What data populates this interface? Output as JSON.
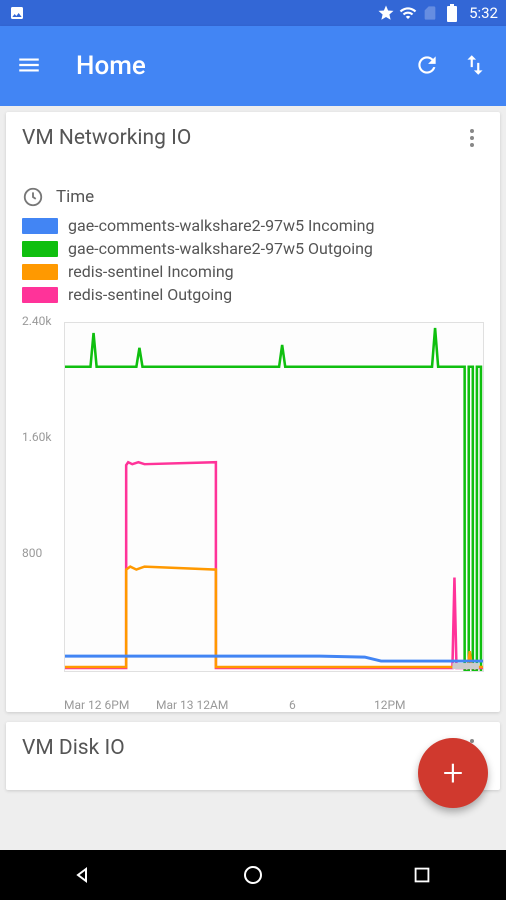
{
  "status": {
    "time": "5:32"
  },
  "appbar": {
    "title": "Home"
  },
  "card1": {
    "title": "VM Networking IO",
    "time_label": "Time",
    "legend": [
      {
        "label": "gae-comments-walkshare2-97w5 Incoming",
        "color": "#4285F4"
      },
      {
        "label": "gae-comments-walkshare2-97w5 Outgoing",
        "color": "#0FBF0F"
      },
      {
        "label": "redis-sentinel Incoming",
        "color": "#FF9900"
      },
      {
        "label": "redis-sentinel Outgoing",
        "color": "#FF3399"
      }
    ],
    "y_ticks": [
      "2.40k",
      "1.60k",
      "800"
    ],
    "x_ticks": [
      "Mar 12 6PM",
      "Mar 13 12AM",
      "6",
      "12PM"
    ]
  },
  "card2": {
    "title": "VM Disk IO"
  },
  "fab": {
    "label": "+"
  },
  "chart_data": {
    "type": "line",
    "title": "VM Networking IO",
    "xlabel": "Time",
    "ylabel": "",
    "ylim": [
      0,
      2400
    ],
    "x_range": [
      "Mar 12 6PM",
      "Mar 13 ~4PM"
    ],
    "series": [
      {
        "name": "gae-comments-walkshare2-97w5 Incoming",
        "color": "#4285F4",
        "approx_values": [
          {
            "x": "Mar 12 6PM",
            "y": 100
          },
          {
            "x": "Mar 13 12AM",
            "y": 100
          },
          {
            "x": "Mar 13 6AM",
            "y": 100
          },
          {
            "x": "Mar 13 12PM",
            "y": 100
          },
          {
            "x": "Mar 13 4PM",
            "y": 100
          }
        ]
      },
      {
        "name": "gae-comments-walkshare2-97w5 Outgoing",
        "color": "#0FBF0F",
        "approx_values": [
          {
            "x": "Mar 12 6PM",
            "y": 2100
          },
          {
            "x": "Mar 12 7PM_spike",
            "y": 2350
          },
          {
            "x": "Mar 13 12AM",
            "y": 2100
          },
          {
            "x": "Mar 13 3AM_spike",
            "y": 2300
          },
          {
            "x": "Mar 13 6AM",
            "y": 2100
          },
          {
            "x": "Mar 13 12PM",
            "y": 2100
          },
          {
            "x": "Mar 13 2PM_spike",
            "y": 2400
          },
          {
            "x": "Mar 13 4PM",
            "y": 2100
          },
          {
            "x": "Mar 13 4PM_drop",
            "y": 0
          }
        ]
      },
      {
        "name": "redis-sentinel Incoming",
        "color": "#FF9900",
        "approx_values": [
          {
            "x": "Mar 12 6PM",
            "y": 30
          },
          {
            "x": "Mar 12 8PM",
            "y": 30
          },
          {
            "x": "Mar 12 8PM_step",
            "y": 700
          },
          {
            "x": "Mar 13 12AM",
            "y": 700
          },
          {
            "x": "Mar 13 1AM_drop",
            "y": 30
          },
          {
            "x": "Mar 13 6AM",
            "y": 30
          },
          {
            "x": "Mar 13 12PM",
            "y": 30
          },
          {
            "x": "Mar 13 4PM",
            "y": 30
          }
        ]
      },
      {
        "name": "redis-sentinel Outgoing",
        "color": "#FF3399",
        "approx_values": [
          {
            "x": "Mar 12 6PM",
            "y": 20
          },
          {
            "x": "Mar 12 8PM",
            "y": 20
          },
          {
            "x": "Mar 12 8PM_step",
            "y": 1420
          },
          {
            "x": "Mar 13 12AM",
            "y": 1420
          },
          {
            "x": "Mar 13 1AM_drop",
            "y": 20
          },
          {
            "x": "Mar 13 6AM",
            "y": 20
          },
          {
            "x": "Mar 13 12PM",
            "y": 20
          },
          {
            "x": "Mar 13 3PM_spike",
            "y": 650
          },
          {
            "x": "Mar 13 4PM",
            "y": 20
          }
        ]
      }
    ]
  }
}
